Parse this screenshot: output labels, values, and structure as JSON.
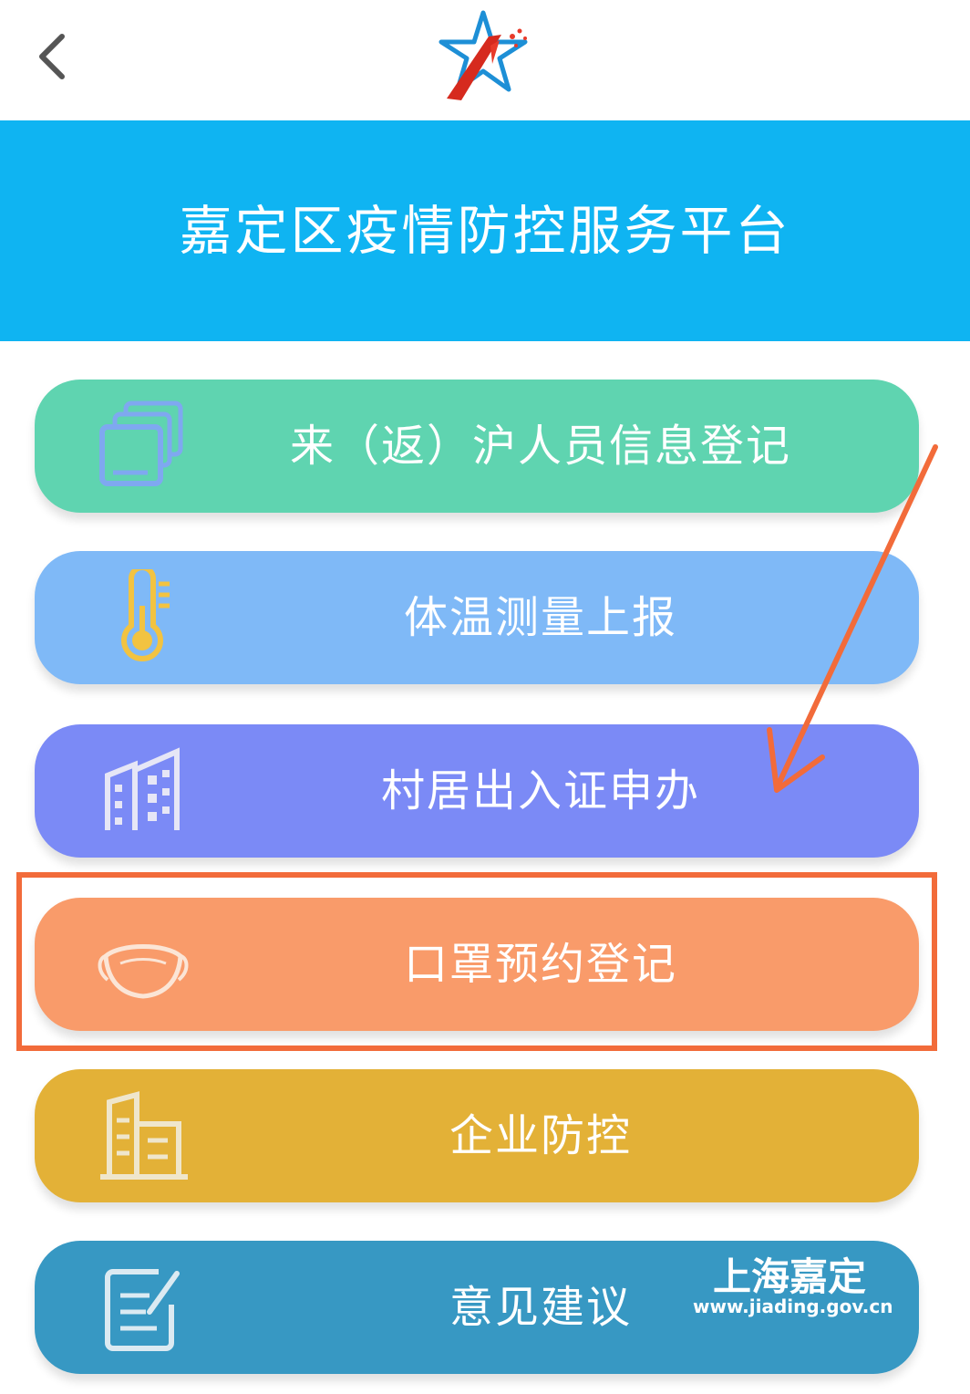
{
  "header": {
    "back_icon": "chevron-left-icon",
    "logo_icon": "star-logo-icon"
  },
  "banner": {
    "title": "嘉定区疫情防控服务平台",
    "color": "#0fb4f2"
  },
  "menu": [
    {
      "label": "来（返）沪人员信息登记",
      "icon": "documents-stack-icon",
      "color": "#5fd4b0"
    },
    {
      "label": "体温测量上报",
      "icon": "thermometer-icon",
      "color": "#7fb9f7"
    },
    {
      "label": "村居出入证申办",
      "icon": "buildings-icon",
      "color": "#7b8af6"
    },
    {
      "label": "口罩预约登记",
      "icon": "face-mask-icon",
      "color": "#f99b6a"
    },
    {
      "label": "企业防控",
      "icon": "office-building-icon",
      "color": "#e3b137"
    },
    {
      "label": "意见建议",
      "icon": "edit-note-icon",
      "color": "#3798c3"
    }
  ],
  "annotations": {
    "highlight_color": "#f26b3a",
    "arrow_color": "#f26b3a"
  },
  "watermark": {
    "title": "上海嘉定",
    "url": "www.jiading.gov.cn"
  }
}
